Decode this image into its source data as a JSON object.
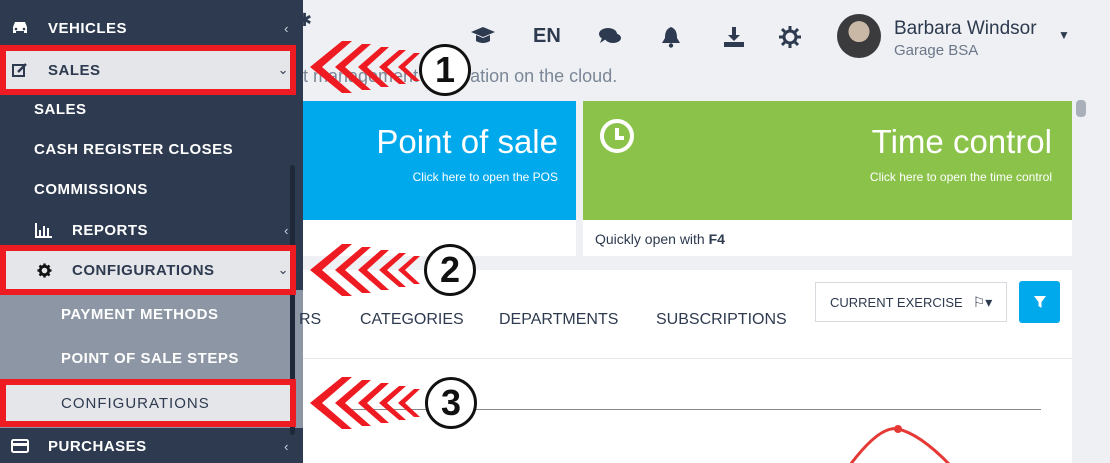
{
  "sidebar": {
    "items": [
      {
        "label": "VEHICLES",
        "icon": "car-icon"
      },
      {
        "label": "SALES",
        "icon": "edit-icon"
      },
      {
        "label": "SALES"
      },
      {
        "label": "CASH REGISTER CLOSES"
      },
      {
        "label": "COMMISSIONS"
      },
      {
        "label": "REPORTS",
        "icon": "bar-chart-icon"
      },
      {
        "label": "CONFIGURATIONS",
        "icon": "gear-icon"
      },
      {
        "label": "PAYMENT METHODS"
      },
      {
        "label": "POINT OF SALE STEPS"
      },
      {
        "label": "CONFIGURATIONS"
      },
      {
        "label": "PURCHASES",
        "icon": "card-icon"
      }
    ]
  },
  "header": {
    "language": "EN",
    "user_name": "Barbara Windsor",
    "user_company": "Garage BSA",
    "subtitle": "t management application on the cloud.",
    "icons": [
      "graduation-cap-icon",
      "comments-icon",
      "bell-icon",
      "download-icon",
      "settings-icon",
      "gear-icon"
    ]
  },
  "cards": {
    "pos": {
      "title": "Point of sale",
      "subtitle": "Click here to open the POS"
    },
    "time_control": {
      "title": "Time control",
      "subtitle": "Click here to open the time control",
      "footer_prefix": "Quickly open with ",
      "footer_key": "F4"
    }
  },
  "panel": {
    "tabs": [
      "RS",
      "CATEGORIES",
      "DEPARTMENTS",
      "SUBSCRIPTIONS"
    ],
    "exercise_label": "CURRENT EXERCISE"
  },
  "annotations": {
    "steps": [
      "1",
      "2",
      "3"
    ],
    "color": "#ee1b22"
  },
  "colors": {
    "sidebar": "#2d3a4f",
    "pos_card": "#00a8ec",
    "time_card": "#8bc34a",
    "highlight": "#ee1b22"
  }
}
